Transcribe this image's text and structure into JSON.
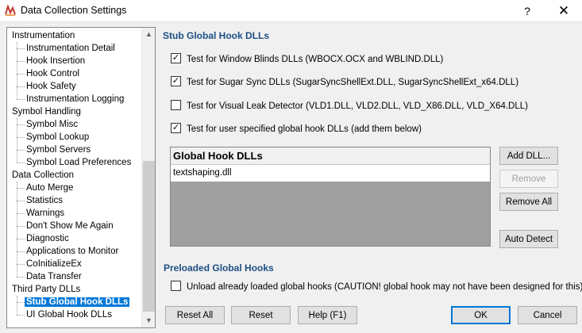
{
  "window": {
    "title": "Data Collection Settings",
    "help_label": "?",
    "close_label": "✕"
  },
  "tree": {
    "items": [
      {
        "label": "Instrumentation",
        "level": 0
      },
      {
        "label": "Instrumentation Detail",
        "level": 1
      },
      {
        "label": "Hook Insertion",
        "level": 1
      },
      {
        "label": "Hook Control",
        "level": 1
      },
      {
        "label": "Hook Safety",
        "level": 1
      },
      {
        "label": "Instrumentation Logging",
        "level": 1
      },
      {
        "label": "Symbol Handling",
        "level": 0
      },
      {
        "label": "Symbol Misc",
        "level": 1
      },
      {
        "label": "Symbol Lookup",
        "level": 1
      },
      {
        "label": "Symbol Servers",
        "level": 1
      },
      {
        "label": "Symbol Load Preferences",
        "level": 1
      },
      {
        "label": "Data Collection",
        "level": 0
      },
      {
        "label": "Auto Merge",
        "level": 1
      },
      {
        "label": "Statistics",
        "level": 1
      },
      {
        "label": "Warnings",
        "level": 1
      },
      {
        "label": "Don't Show Me Again",
        "level": 1
      },
      {
        "label": "Diagnostic",
        "level": 1
      },
      {
        "label": "Applications to Monitor",
        "level": 1
      },
      {
        "label": "CoInitializeEx",
        "level": 1
      },
      {
        "label": "Data Transfer",
        "level": 1
      },
      {
        "label": "Third Party DLLs",
        "level": 0
      },
      {
        "label": "Stub Global Hook DLLs",
        "level": 1,
        "selected": true
      },
      {
        "label": "UI Global Hook DLLs",
        "level": 1
      }
    ]
  },
  "stub_section": {
    "title": "Stub Global Hook DLLs",
    "checks": [
      {
        "label": "Test for Window Blinds DLLs (WBOCX.OCX and WBLIND.DLL)",
        "checked": "✓"
      },
      {
        "label": "Test for Sugar Sync DLLs (SugarSyncShellExt.DLL, SugarSyncShellExt_x64.DLL)",
        "checked": "✓"
      },
      {
        "label": "Test for Visual Leak Detector (VLD1.DLL, VLD2.DLL, VLD_X86.DLL, VLD_X64.DLL)",
        "checked": ""
      },
      {
        "label": "Test for user specified global hook DLLs (add them below)",
        "checked": "✓"
      }
    ],
    "list_header": "Global Hook DLLs",
    "list_items": [
      "textshaping.dll"
    ],
    "buttons": {
      "add": "Add DLL...",
      "remove": "Remove",
      "remove_all": "Remove All",
      "auto_detect": "Auto Detect"
    }
  },
  "preloaded_section": {
    "title": "Preloaded Global Hooks",
    "check_label": "Unload already loaded global hooks (CAUTION! global hook may not have been designed for this).",
    "checked": ""
  },
  "footer": {
    "reset_all": "Reset All",
    "reset": "Reset",
    "help": "Help (F1)",
    "ok": "OK",
    "cancel": "Cancel"
  },
  "colors": {
    "selection": "#0078d7",
    "section_title": "#1d4f84",
    "list_empty_area": "#a0a0a0"
  }
}
